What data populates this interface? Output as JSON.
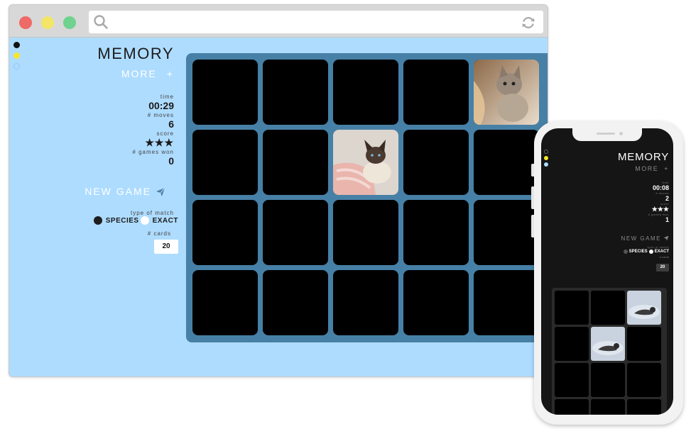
{
  "browser": {
    "window_dots": {
      "close": "#ee6a66",
      "minimize": "#f3e667",
      "maximize": "#6fd28e"
    },
    "address_bar": {
      "value": ""
    },
    "theme_dots": [
      "#111111",
      "#f5e62d",
      "#aedcff"
    ]
  },
  "sidebar": {
    "title": "MEMORY",
    "more_label": "MORE",
    "more_plus": "+",
    "stats": [
      {
        "label": "time",
        "value": "00:29"
      },
      {
        "label": "# moves",
        "value": "6"
      },
      {
        "label": "score",
        "value": "★★★"
      },
      {
        "label": "# games won",
        "value": "0"
      }
    ],
    "new_game_label": "NEW GAME",
    "match_type_label": "type of match",
    "match_options": [
      {
        "label": "SPECIES",
        "selected": true
      },
      {
        "label": "EXACT",
        "selected": false
      }
    ],
    "cards_label": "# cards",
    "cards_value": "20"
  },
  "board": {
    "colors": {
      "background": "#4780a6",
      "card": "#000000"
    },
    "rows": 4,
    "cols": 5,
    "revealed": [
      {
        "index": 4,
        "image": "kitten-tabby-photo"
      },
      {
        "index": 7,
        "image": "kitten-siamese-photo"
      }
    ]
  },
  "phone": {
    "theme_dots": [
      "#111111",
      "#f5e62d",
      "#aedcff"
    ],
    "title": "MEMORY",
    "more_label": "MORE",
    "more_plus": "+",
    "stats": [
      {
        "label": "time",
        "value": "00:08"
      },
      {
        "label": "# moves",
        "value": "2"
      },
      {
        "label": "score",
        "value": "★★★"
      },
      {
        "label": "# games won",
        "value": "1"
      }
    ],
    "new_game_label": "NEW GAME",
    "match_type_label": "type of match",
    "match_options": [
      {
        "label": "SPECIES",
        "selected": true
      },
      {
        "label": "EXACT",
        "selected": false
      }
    ],
    "cards_label": "# cards",
    "cards_value": "20",
    "board": {
      "rows": 4,
      "cols": 3,
      "revealed": [
        {
          "index": 2,
          "image": "otter-photo"
        },
        {
          "index": 4,
          "image": "otter-photo"
        }
      ]
    }
  }
}
